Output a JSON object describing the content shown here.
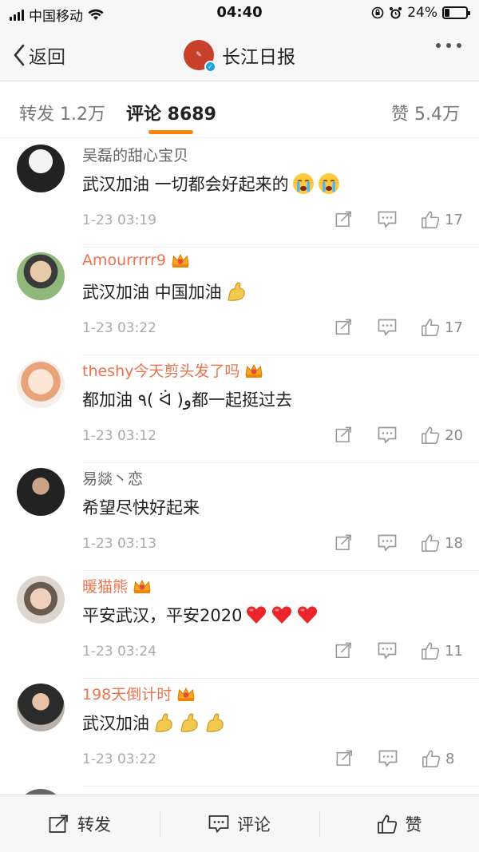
{
  "status_bar": {
    "carrier": "中国移动",
    "time": "04:40",
    "battery": "24%",
    "battery_level": 0.24
  },
  "nav": {
    "back_label": "返回",
    "title": "长江日报"
  },
  "tabs": {
    "repost": "转发 1.2万",
    "comment": "评论 8689",
    "like": "赞 5.4万"
  },
  "comments": [
    {
      "name": "吴磊的甜心宝贝",
      "vip": false,
      "text": "武汉加油 一切都会好起来的",
      "emojis": [
        "crying-emoji",
        "crying-emoji"
      ],
      "time": "1-23 03:19",
      "likes": "17"
    },
    {
      "name": "Amourrrrr9",
      "vip": true,
      "text": "武汉加油 中国加油",
      "emojis": [
        "strong-arm-emoji"
      ],
      "time": "1-23 03:22",
      "likes": "17"
    },
    {
      "name": "theshy今天剪头发了吗",
      "vip": true,
      "text": "都加油 ٩( ᐛ )و都一起挺过去",
      "emojis": [],
      "time": "1-23 03:12",
      "likes": "20"
    },
    {
      "name": "易燚丶恋",
      "vip": false,
      "text": "希望尽快好起来",
      "emojis": [],
      "time": "1-23 03:13",
      "likes": "18"
    },
    {
      "name": "暖猫熊",
      "vip": true,
      "text": "平安武汉，平安2020",
      "emojis": [
        "heart-emoji",
        "heart-emoji",
        "heart-emoji"
      ],
      "time": "1-23 03:24",
      "likes": "11"
    },
    {
      "name": "198天倒计时",
      "vip": true,
      "text": "武汉加油",
      "emojis": [
        "strong-arm-emoji",
        "strong-arm-emoji",
        "strong-arm-emoji"
      ],
      "time": "1-23 03:22",
      "likes": "8"
    }
  ],
  "bottom_bar": {
    "repost": "转发",
    "comment": "评论",
    "like": "赞"
  },
  "colors": {
    "accent": "#ff8200",
    "vip_name": "#eb7350",
    "time": "#aaaaaa"
  }
}
